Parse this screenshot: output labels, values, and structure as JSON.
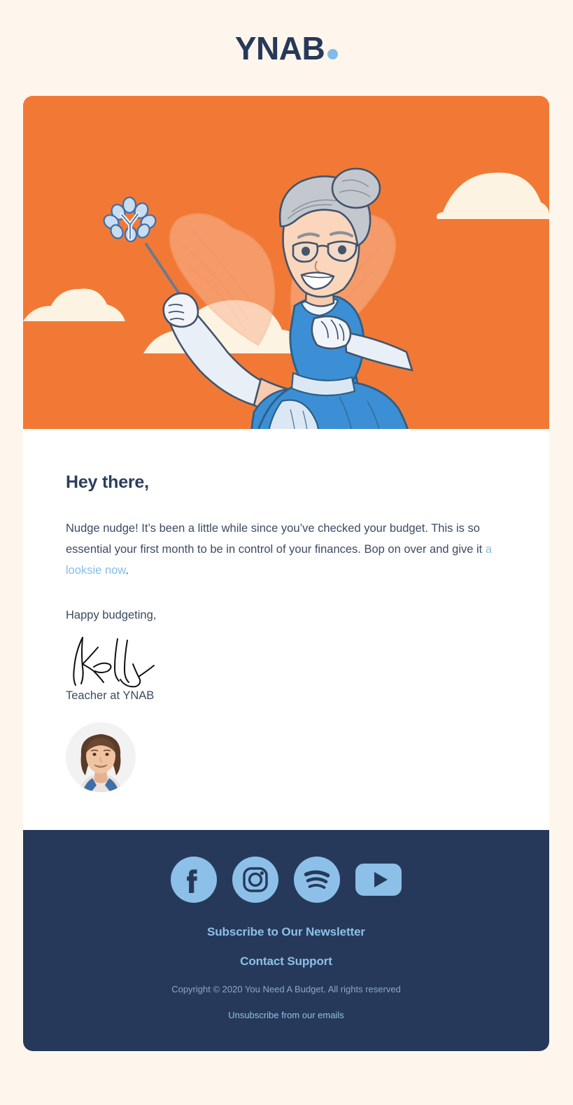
{
  "brand": {
    "logo_text": "YNAB",
    "logo_dot": "dot",
    "navy": "#27395A",
    "orange": "#F27935",
    "light_blue": "#85BEE8",
    "cream": "#FEF6EC"
  },
  "hero": {
    "alt": "fairy godmother with magic wand flying in orange sky with clouds",
    "background_color": "#F27935",
    "cloud_color": "#FDF3E3"
  },
  "body": {
    "greeting": "Hey there,",
    "paragraph_part1": "Nudge nudge! It’s been a little while since you’ve checked your budget. This is so essential your first month to be in control of your finances. Bop on over and give it ",
    "paragraph_link": "a looksie now",
    "paragraph_part2": ".",
    "signoff": "Happy budgeting,",
    "signature_name": "Kelly",
    "role": "Teacher at YNAB",
    "avatar_alt": "headshot of Kelly"
  },
  "footer": {
    "social": [
      {
        "name": "facebook",
        "label": "Facebook"
      },
      {
        "name": "instagram",
        "label": "Instagram"
      },
      {
        "name": "spotify",
        "label": "Spotify"
      },
      {
        "name": "youtube",
        "label": "YouTube"
      }
    ],
    "newsletter_link": "Subscribe to Our Newsletter",
    "support_link": "Contact Support",
    "copyright": "Copyright © 2020 You Need A Budget. All rights reserved",
    "unsubscribe_link": "Unsubscribe from our emails"
  }
}
